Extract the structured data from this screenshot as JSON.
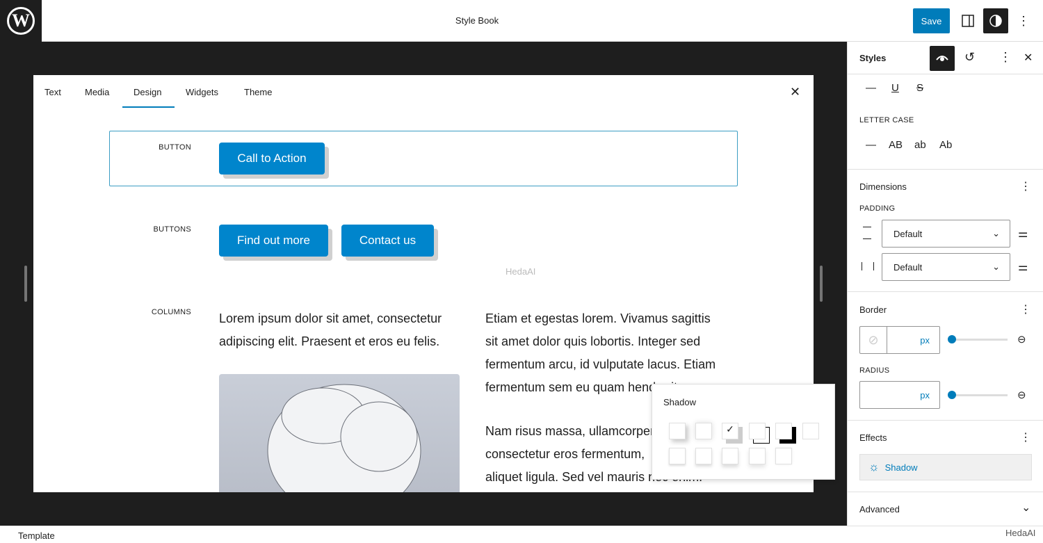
{
  "header": {
    "title": "Style Book",
    "save_label": "Save",
    "logo_text": "W"
  },
  "tabs": [
    "Text",
    "Media",
    "Design",
    "Widgets",
    "Theme"
  ],
  "active_tab": "Design",
  "sections": {
    "button": {
      "label": "BUTTON",
      "button": "Call to Action"
    },
    "buttons": {
      "label": "BUTTONS",
      "items": [
        "Find out more",
        "Contact us"
      ]
    },
    "columns": {
      "label": "COLUMNS",
      "col1": [
        "Lorem ipsum dolor sit amet, consectetur",
        "adipiscing elit. Praesent et eros eu felis."
      ],
      "col2": [
        "Etiam et egestas lorem. Vivamus sagittis",
        "sit amet dolor quis lobortis. Integer sed",
        "fermentum arcu, id vulputate lacus. Etiam",
        "fermentum sem eu quam hendrerit."
      ],
      "col2b": [
        "Nam risus massa, ullamcorper",
        "consectetur eros fermentum,",
        "aliquet ligula. Sed vel mauris nec enim."
      ]
    }
  },
  "popover": {
    "title": "Shadow",
    "selected_index": 2
  },
  "sidebar": {
    "title": "Styles",
    "decoration_options": [
      "—",
      "U",
      "S"
    ],
    "letter_case_label": "LETTER CASE",
    "letter_case_options": [
      "—",
      "AB",
      "ab",
      "Ab"
    ],
    "dimensions": {
      "title": "Dimensions",
      "padding_label": "PADDING",
      "vertical": "Default",
      "horizontal": "Default"
    },
    "border": {
      "title": "Border",
      "unit": "px",
      "radius_label": "RADIUS",
      "radius_unit": "px",
      "width_slider": 0,
      "radius_slider": 0
    },
    "effects": {
      "title": "Effects",
      "shadow_label": "Shadow"
    },
    "advanced": {
      "title": "Advanced"
    }
  },
  "footer": {
    "breadcrumb": "Template"
  },
  "watermark": "HedaAI",
  "colors": {
    "accent": "#007cba",
    "button": "#0085cc",
    "dark": "#1e1e1e"
  }
}
